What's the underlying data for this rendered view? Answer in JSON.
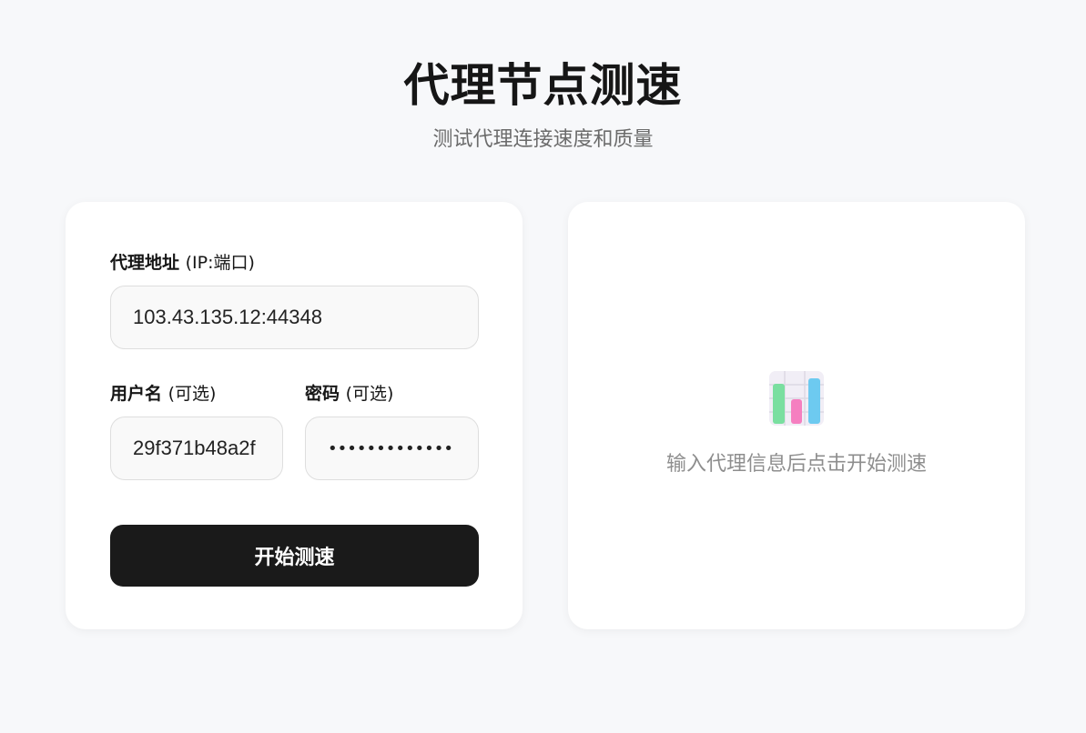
{
  "header": {
    "title": "代理节点测速",
    "subtitle": "测试代理连接速度和质量"
  },
  "form": {
    "proxy_label": "代理地址",
    "proxy_hint": "(IP:端口)",
    "proxy_value": "103.43.135.12:44348",
    "username_label": "用户名",
    "username_hint": "(可选)",
    "username_value": "29f371b48a2f",
    "password_label": "密码",
    "password_hint": "(可选)",
    "password_value": "•••••••••••••",
    "submit_label": "开始测速"
  },
  "result": {
    "icon": "bar-chart-icon",
    "empty_text": "输入代理信息后点击开始测速"
  }
}
